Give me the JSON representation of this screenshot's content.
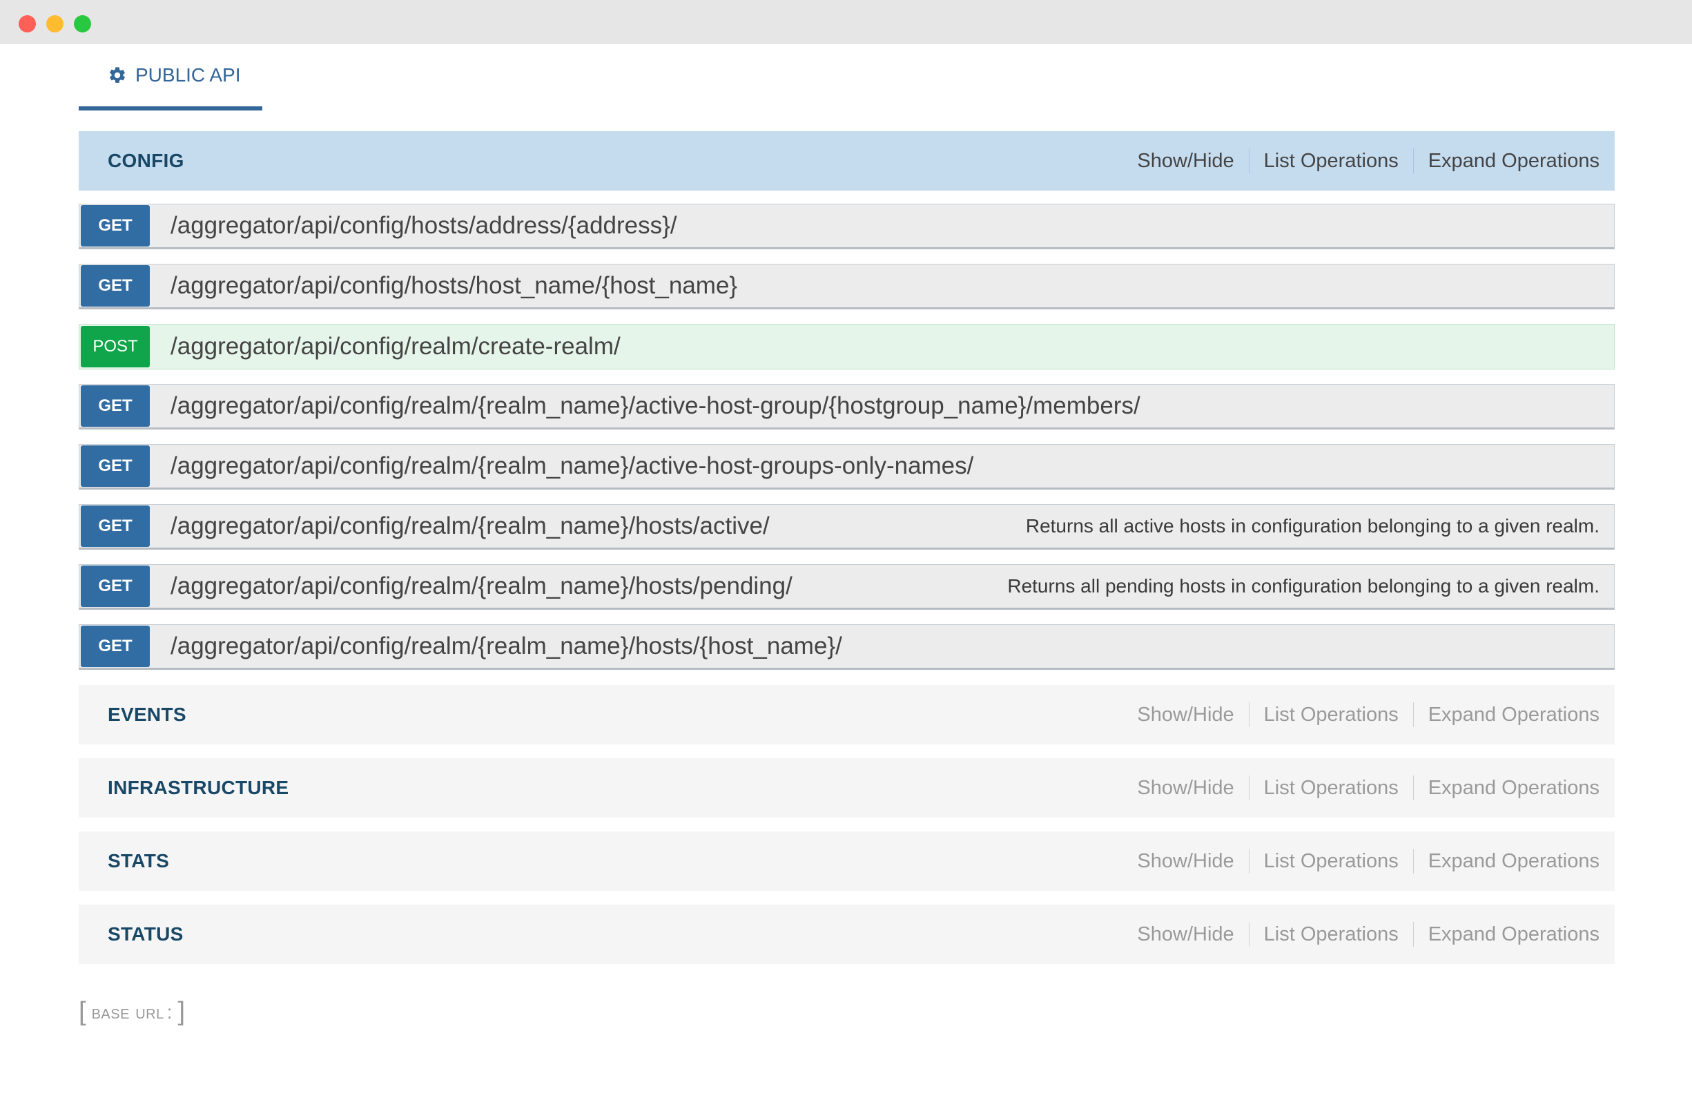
{
  "window": {
    "controls": [
      "close",
      "minimize",
      "maximize"
    ]
  },
  "tab": {
    "label": "PUBLIC API",
    "icon": "gear-icon"
  },
  "actions": {
    "show_hide": "Show/Hide",
    "list_operations": "List Operations",
    "expand_operations": "Expand Operations"
  },
  "resources": [
    {
      "name": "CONFIG",
      "expanded": true,
      "operations": [
        {
          "method": "GET",
          "path": "/aggregator/api/config/hosts/address/{address}/",
          "description": ""
        },
        {
          "method": "GET",
          "path": "/aggregator/api/config/hosts/host_name/{host_name}",
          "description": ""
        },
        {
          "method": "POST",
          "path": "/aggregator/api/config/realm/create-realm/",
          "description": ""
        },
        {
          "method": "GET",
          "path": "/aggregator/api/config/realm/{realm_name}/active-host-group/{hostgroup_name}/members/",
          "description": ""
        },
        {
          "method": "GET",
          "path": "/aggregator/api/config/realm/{realm_name}/active-host-groups-only-names/",
          "description": ""
        },
        {
          "method": "GET",
          "path": "/aggregator/api/config/realm/{realm_name}/hosts/active/",
          "description": "Returns all active hosts in configuration belonging to a given realm."
        },
        {
          "method": "GET",
          "path": "/aggregator/api/config/realm/{realm_name}/hosts/pending/",
          "description": "Returns all pending hosts in configuration belonging to a given realm."
        },
        {
          "method": "GET",
          "path": "/aggregator/api/config/realm/{realm_name}/hosts/{host_name}/",
          "description": ""
        }
      ]
    },
    {
      "name": "EVENTS",
      "expanded": false
    },
    {
      "name": "INFRASTRUCTURE",
      "expanded": false
    },
    {
      "name": "STATS",
      "expanded": false
    },
    {
      "name": "STATUS",
      "expanded": false
    }
  ],
  "footer": {
    "open_bracket": "[",
    "base_url_label": "base url",
    "colon": ":",
    "close_bracket": "]"
  },
  "colors": {
    "get": "#316da3",
    "post": "#10a54a",
    "active_header": "#c5dbee",
    "tab_accent": "#336699"
  }
}
